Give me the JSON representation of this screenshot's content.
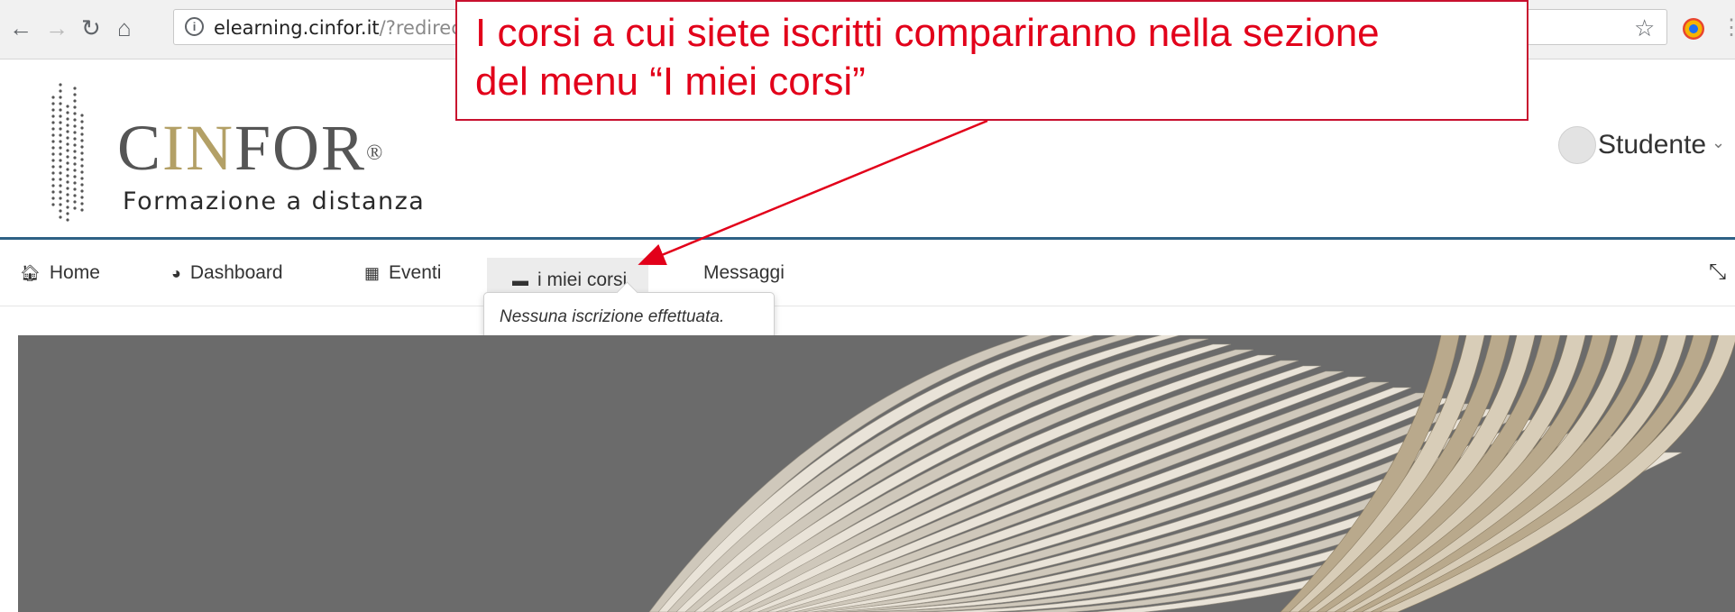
{
  "browser": {
    "url_host": "elearning.cinfor.it",
    "url_rest": "/?redirec",
    "icons": [
      "back-arrow-icon",
      "forward-arrow-icon",
      "reload-icon",
      "home-icon",
      "info-icon",
      "star-icon",
      "extension-icon"
    ]
  },
  "brand": {
    "name_prefix": "C",
    "name_accent": "IN",
    "name_suffix": "FOR",
    "registered": "®",
    "subtitle": "Formazione a distanza",
    "accent_color": "#b3a066",
    "rule_color": "#2e6185"
  },
  "user": {
    "name": "Studente"
  },
  "nav": {
    "items": [
      {
        "label": "Home",
        "icon": "home-icon"
      },
      {
        "label": "Dashboard",
        "icon": "dashboard-icon"
      },
      {
        "label": "Eventi",
        "icon": "calendar-icon"
      },
      {
        "label": "i miei corsi",
        "icon": "briefcase-icon"
      },
      {
        "label": "Messaggi"
      }
    ],
    "collapse_icon": "collapse-arrows-icon",
    "dropdown_text": "Nessuna iscrizione effettuata."
  },
  "callout": {
    "line1": "I corsi a cui siete iscritti compariranno nella sezione",
    "line2": "del menu “I miei corsi”",
    "color": "#e2001a"
  }
}
